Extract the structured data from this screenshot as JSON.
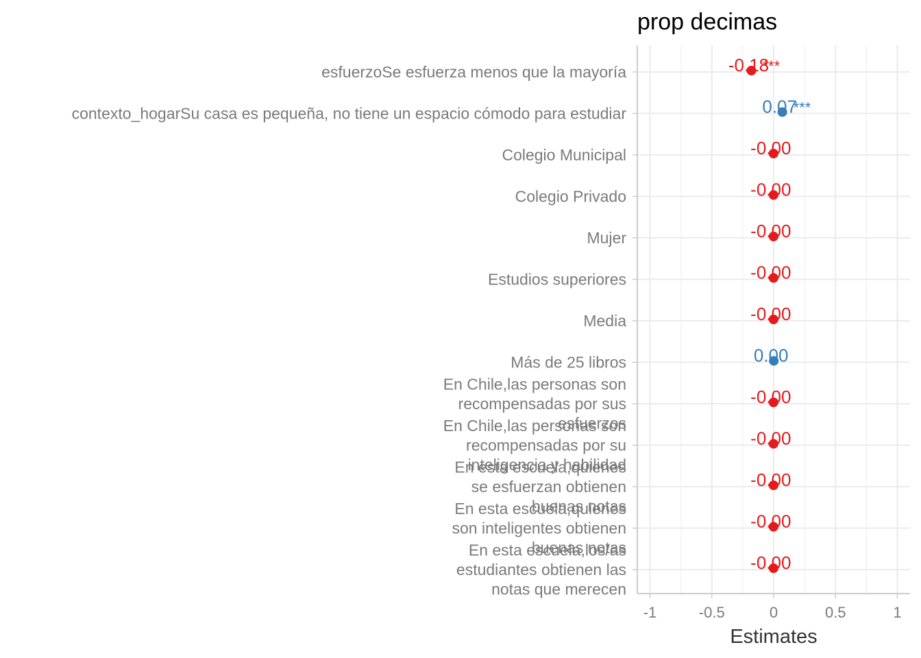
{
  "chart_data": {
    "type": "scatter",
    "title": "prop decimas",
    "xlabel": "Estimates",
    "ylabel": "",
    "xlim": [
      -1,
      1
    ],
    "xticks": [
      -1,
      -0.5,
      0,
      0.5,
      1
    ],
    "xtick_labels": [
      "-1",
      "-0.5",
      "0",
      "0.5",
      "1"
    ],
    "grid": true,
    "legend": "none",
    "colors": {
      "negative": "#e41a1c",
      "positive": "#377eb8"
    },
    "terms": [
      {
        "label_lines": [
          "esfuerzoSe esfuerza menos que la mayoría"
        ],
        "estimate": -0.18,
        "value_label": "-0.18",
        "sig": "***",
        "sign": "negative"
      },
      {
        "label_lines": [
          "contexto_hogarSu casa es pequeña, no tiene un espacio cómodo para estudiar"
        ],
        "estimate": 0.07,
        "value_label": "0.07",
        "sig": "***",
        "sign": "positive"
      },
      {
        "label_lines": [
          "Colegio Municipal"
        ],
        "estimate": -0.001,
        "value_label": "-0.00",
        "sig": "",
        "sign": "negative"
      },
      {
        "label_lines": [
          "Colegio Privado"
        ],
        "estimate": -0.001,
        "value_label": "-0.00",
        "sig": "",
        "sign": "negative"
      },
      {
        "label_lines": [
          "Mujer"
        ],
        "estimate": -0.001,
        "value_label": "-0.00",
        "sig": "",
        "sign": "negative"
      },
      {
        "label_lines": [
          "Estudios superiores"
        ],
        "estimate": -0.001,
        "value_label": "-0.00",
        "sig": "",
        "sign": "negative"
      },
      {
        "label_lines": [
          "Media"
        ],
        "estimate": -0.001,
        "value_label": "-0.00",
        "sig": "",
        "sign": "negative"
      },
      {
        "label_lines": [
          "Más de 25 libros"
        ],
        "estimate": 0.001,
        "value_label": "0.00",
        "sig": "",
        "sign": "positive"
      },
      {
        "label_lines": [
          "En Chile,las personas son",
          "recompensadas por sus",
          "esfuerzos"
        ],
        "estimate": -0.001,
        "value_label": "-0.00",
        "sig": "",
        "sign": "negative"
      },
      {
        "label_lines": [
          "En Chile,las personas son",
          "recompensadas por su",
          "inteligencia y habilidad"
        ],
        "estimate": -0.001,
        "value_label": "-0.00",
        "sig": "",
        "sign": "negative"
      },
      {
        "label_lines": [
          "En esta escuela,quienes",
          "se esfuerzan obtienen",
          "buenas notas"
        ],
        "estimate": -0.001,
        "value_label": "-0.00",
        "sig": "",
        "sign": "negative"
      },
      {
        "label_lines": [
          "En esta escuela,quienes",
          "son inteligentes obtienen",
          "buenas notas"
        ],
        "estimate": -0.001,
        "value_label": "-0.00",
        "sig": "",
        "sign": "negative"
      },
      {
        "label_lines": [
          "En esta escuela,los/as",
          "estudiantes obtienen las",
          "notas que merecen"
        ],
        "estimate": -0.001,
        "value_label": "-0.00",
        "sig": "",
        "sign": "negative"
      }
    ]
  }
}
